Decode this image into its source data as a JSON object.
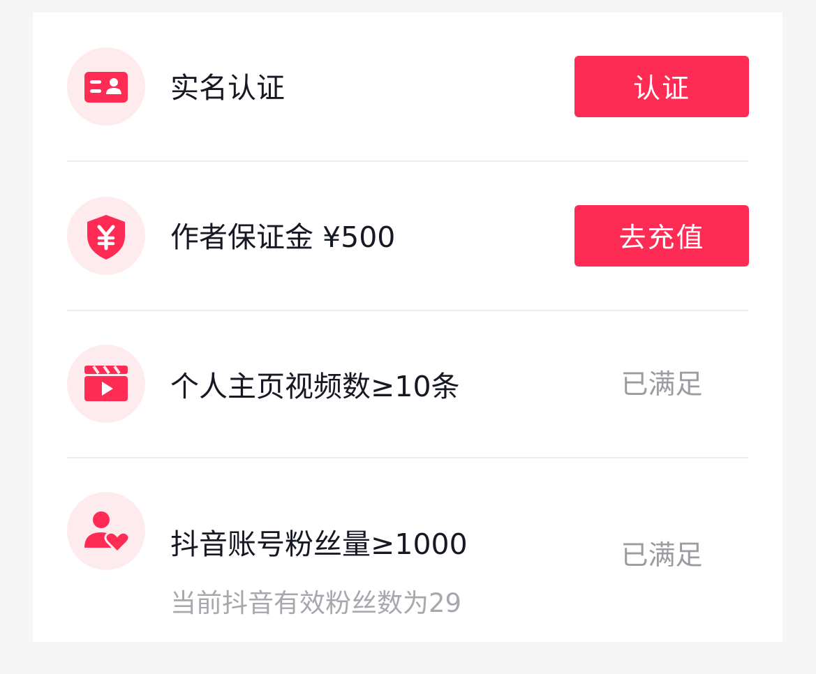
{
  "theme": {
    "accent": "#fe2c55",
    "icon_bg": "#fdebee",
    "text_primary": "#161823",
    "text_secondary": "#a7a8ad"
  },
  "requirements": [
    {
      "icon": "id-card-icon",
      "title": "实名认证",
      "action_label": "认证"
    },
    {
      "icon": "yuan-shield-icon",
      "title": "作者保证金 ¥500",
      "action_label": "去充值"
    },
    {
      "icon": "video-clapper-icon",
      "title": "个人主页视频数≥10条",
      "status": "已满足"
    },
    {
      "icon": "follower-heart-icon",
      "title": "抖音账号粉丝量≥1000",
      "subtitle": "当前抖音有效粉丝数为29",
      "status": "已满足"
    }
  ]
}
